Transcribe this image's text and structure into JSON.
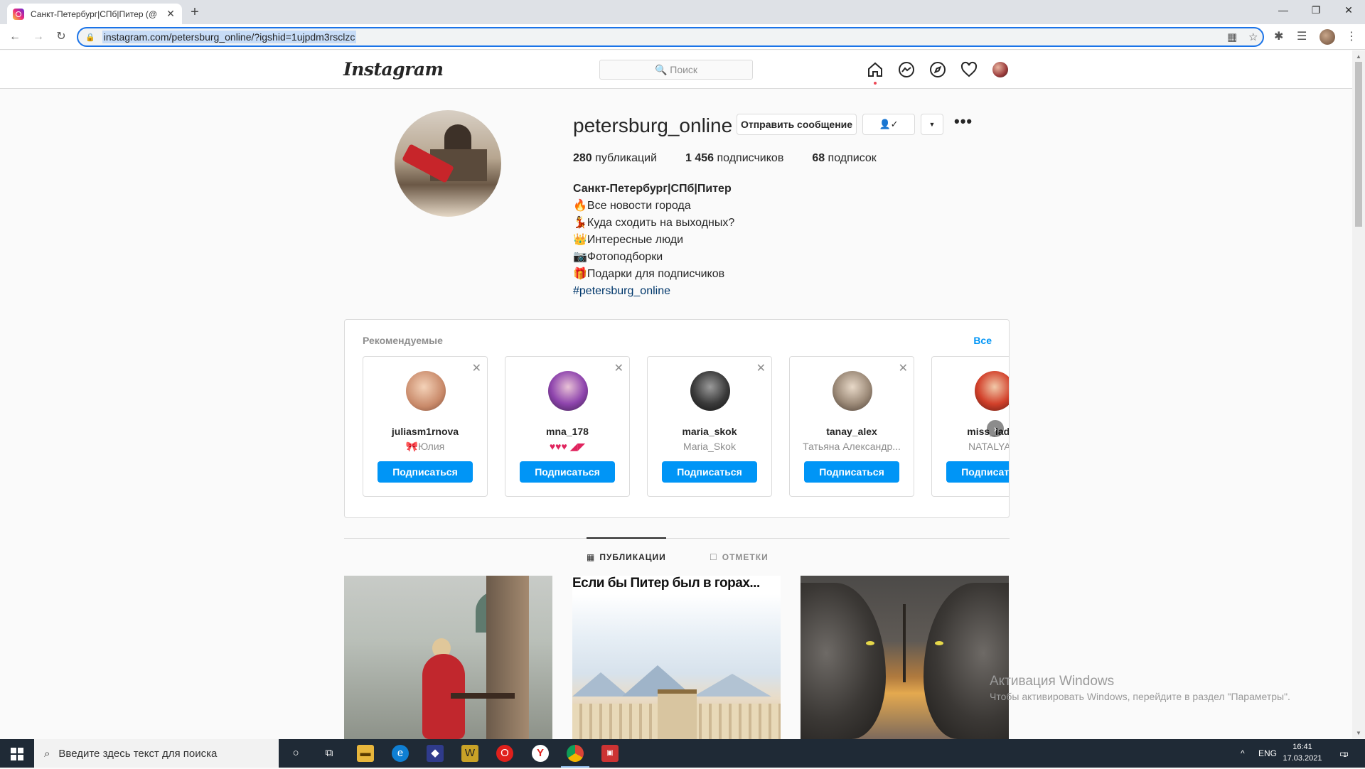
{
  "browser": {
    "tab_title": "Санкт-Петербург|СПб|Питер (@",
    "tab_close": "✕",
    "new_tab": "+",
    "url": "instagram.com/petersburg_online/?igshid=1ujpdm3rsclzc",
    "window_controls": [
      "—",
      "❐",
      "✕"
    ]
  },
  "ig": {
    "logo": "Instagram",
    "search_placeholder": "🔍 Поиск"
  },
  "profile": {
    "username": "petersburg_online",
    "message_button": "Отправить сообщение",
    "follow_icon": "👤✓",
    "dropdown": "▼",
    "more": "•••",
    "stats": {
      "posts_count": "280",
      "posts_label": " публикаций",
      "followers_count": "1 456",
      "followers_label": " подписчиков",
      "following_count": "68",
      "following_label": " подписок"
    },
    "bio": {
      "name": "Санкт-Петербург|СПб|Питер",
      "lines": [
        "🔥Все новости города",
        "💃Куда сходить на выходных?",
        "👑Интересные люди",
        "📷Фотоподборки",
        "🎁Подарки для подписчиков"
      ],
      "hashtag": "#petersburg_online"
    }
  },
  "suggestions": {
    "header": "Рекомендуемые",
    "see_all": "Все",
    "close_glyph": "✕",
    "follow_label": "Подписаться",
    "next_arrow": "›",
    "cards": [
      {
        "username": "juliasm1rnova",
        "subtitle": "🎀Юлия"
      },
      {
        "username": "mna_178",
        "subtitle": "♥♥♥ ◢◤"
      },
      {
        "username": "maria_skok",
        "subtitle": "Maria_Skok"
      },
      {
        "username": "tanay_alex",
        "subtitle": "Татьяна Александр..."
      },
      {
        "username": "miss_lady_",
        "subtitle": "NATALYA K"
      }
    ]
  },
  "tabs": {
    "posts": "ПУБЛИКАЦИИ",
    "tagged": "ОТМЕТКИ"
  },
  "posts": {
    "p2_caption": "Если бы Питер был в горах..."
  },
  "watermark": {
    "line1": "Активация Windows",
    "line2": "Чтобы активировать Windows, перейдите в раздел \"Параметры\"."
  },
  "taskbar": {
    "search_placeholder": "Введите здесь текст для поиска",
    "lang": "ENG",
    "time": "16:41",
    "date": "17.03.2021",
    "tray_up": "^",
    "notif_count": "1"
  },
  "colors": {
    "accent": "#0095f6",
    "chrome_focus": "#1a73e8",
    "taskbar": "#1f2a36"
  }
}
